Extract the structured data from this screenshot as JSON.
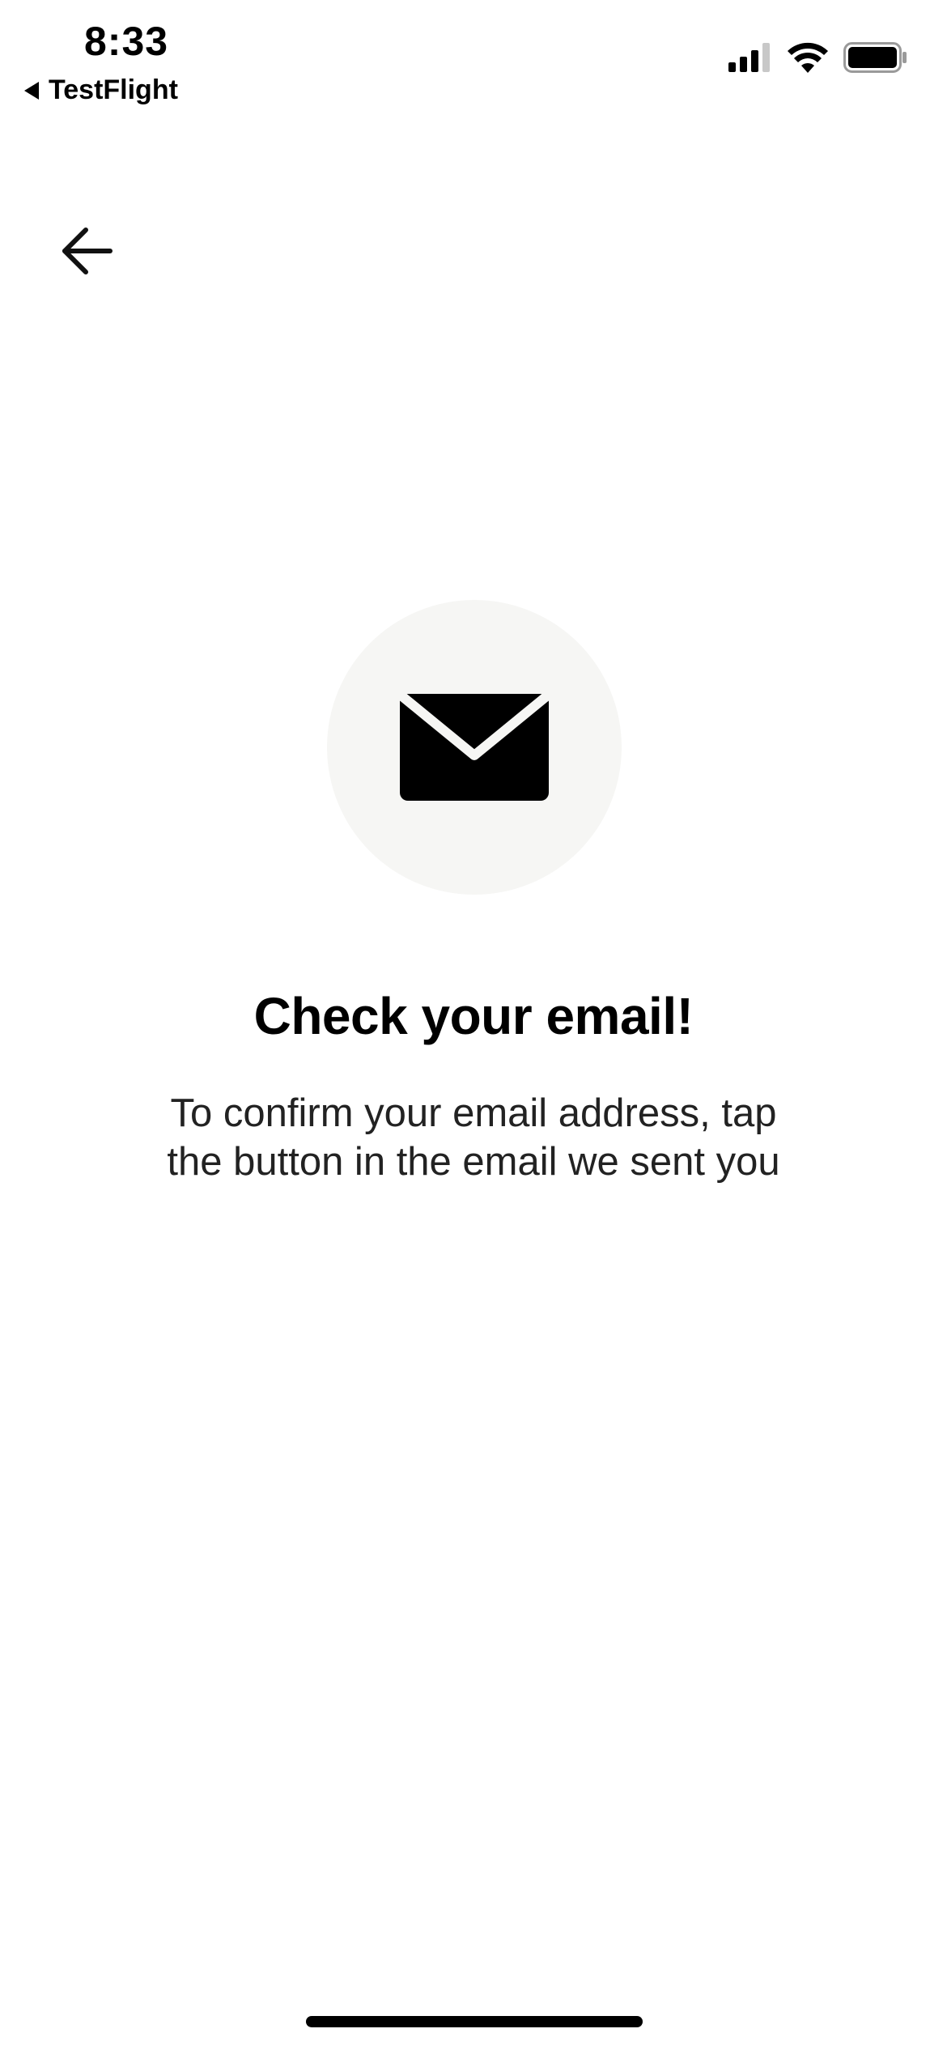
{
  "status_bar": {
    "time": "8:33",
    "back_app_label": "TestFlight"
  },
  "icons": {
    "back": "arrow-left-icon",
    "mail": "envelope-icon",
    "signal": "cellular-signal-icon",
    "wifi": "wifi-icon",
    "battery": "battery-icon"
  },
  "content": {
    "title": "Check your email!",
    "message": "To confirm your email address, tap the button in the email we sent you"
  },
  "colors": {
    "icon_circle_bg": "#f6f6f4",
    "text": "#000000"
  }
}
